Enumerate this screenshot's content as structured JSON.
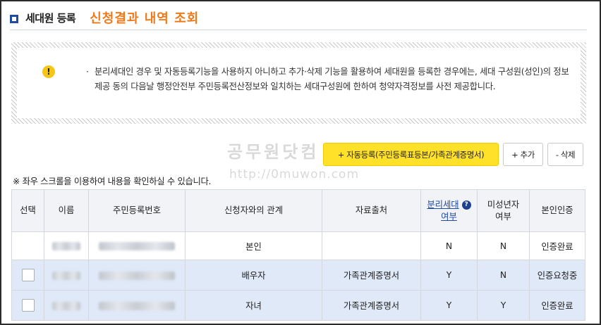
{
  "header": {
    "title": "세대원 등록",
    "annotation": "신청결과 내역 조회"
  },
  "notice": {
    "bullet": "·",
    "text": "분리세대인 경우 및 자동등록기능을 사용하지 아니하고 추가·삭제 기능을 활용하여 세대원을 등록한 경우에는, 세대 구성원(성인)의 정보제공 동의 다음날 행정안전부 주민등록전산정보와 일치하는 세대구성원에 한하여 청약자격정보를 사전 제공합니다.",
    "icon": "exclamation-icon",
    "icon_glyph": "!"
  },
  "toolbar": {
    "auto_register_label": "+ 자동등록(주민등록표등본/가족관계증명서)",
    "add_label": "+ 추가",
    "delete_label": "- 삭제"
  },
  "watermark": {
    "text": "공무원닷컴",
    "url": "http://0muwon.com"
  },
  "scroll_note": "※ 좌우 스크롤을 이용하여 내용을 확인하실 수 있습니다.",
  "table": {
    "headers": {
      "select": "선택",
      "name": "이름",
      "resident_no": "주민등록번호",
      "relation": "신청자와의 관계",
      "source": "자료출처",
      "separate_line1": "분리세대",
      "separate_line2": "여부",
      "minor_line1": "미성년자",
      "minor_line2": "여부",
      "auth": "본인인증"
    },
    "rows": [
      {
        "relation": "본인",
        "source": "",
        "separate": "N",
        "minor": "N",
        "auth": "인증완료",
        "selected": false
      },
      {
        "relation": "배우자",
        "source": "가족관계증명서",
        "separate": "Y",
        "minor": "N",
        "auth": "인증요청중",
        "selected": true
      },
      {
        "relation": "자녀",
        "source": "가족관계증명서",
        "separate": "Y",
        "minor": "Y",
        "auth": "인증완료",
        "selected": true
      }
    ],
    "help_icon_glyph": "?"
  },
  "colors": {
    "accent_blue": "#1f4aa8",
    "annotation_orange": "#f07a1a",
    "auto_button_yellow": "#ffe12a",
    "selected_row": "#dfe9f8"
  }
}
